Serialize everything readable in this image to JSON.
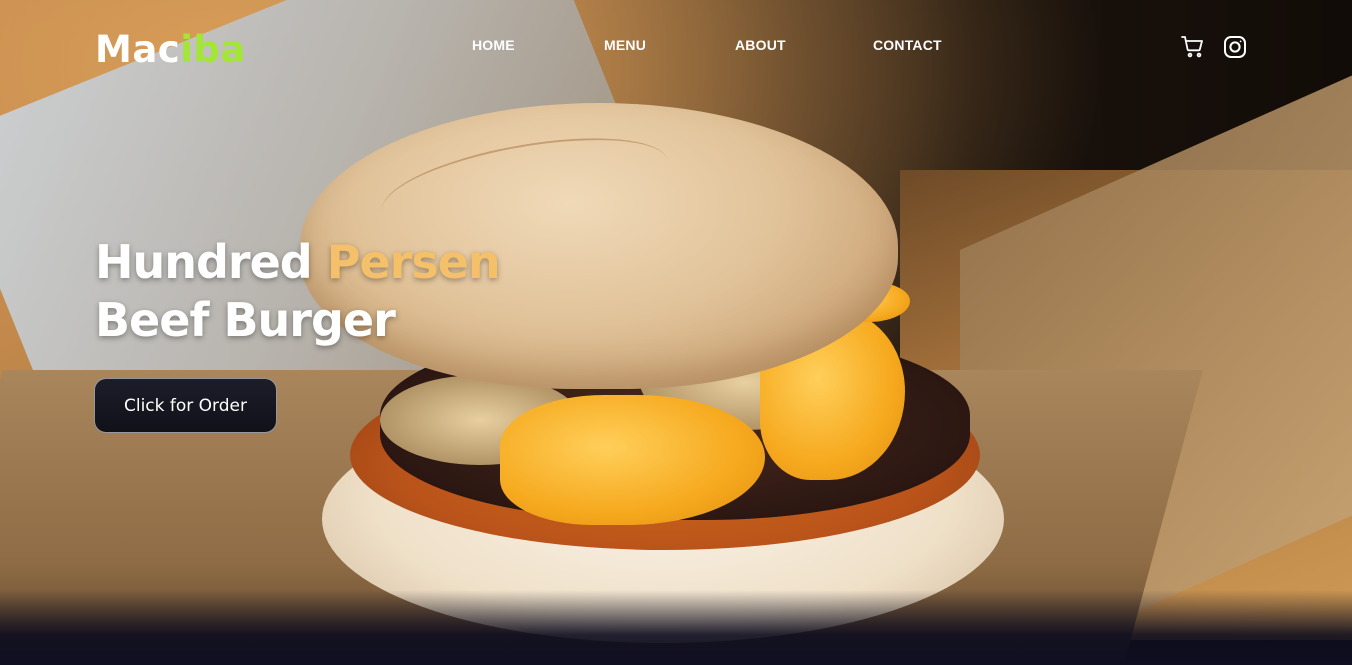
{
  "brand": {
    "logo_part1": "Mac",
    "logo_part2": "iba",
    "accent_color": "#a3e635"
  },
  "nav": {
    "items": [
      {
        "label": "HOME"
      },
      {
        "label": "MENU"
      },
      {
        "label": "ABOUT"
      },
      {
        "label": "CONTACT"
      }
    ],
    "icons": [
      "cart-icon",
      "instagram-icon"
    ]
  },
  "hero": {
    "headline_part1": "Hundred ",
    "headline_accent": "Persen",
    "headline_line2": "Beef Burger",
    "headline_accent_color": "#f4c06a",
    "cta_label": "Click for Order"
  }
}
